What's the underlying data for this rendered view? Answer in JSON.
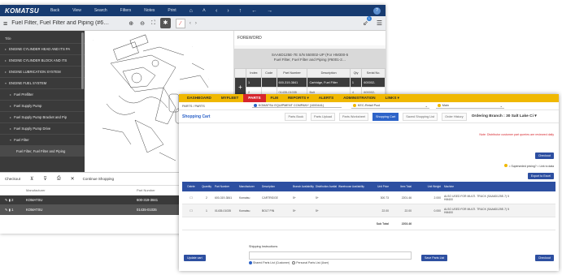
{
  "win1": {
    "top": {
      "logo": "KOMATSU",
      "nav": [
        "Back",
        "View",
        "Search",
        "Filters",
        "Notes",
        "Print"
      ],
      "help": "?"
    },
    "bar": {
      "title": "Fuel Filter, Fuel Filter and Piping (#6…",
      "badge": "1"
    },
    "sidebar": {
      "title": "Title",
      "items": [
        {
          "label": "ENGINE CYLINDER HEAD AND ITS PA"
        },
        {
          "label": "ENGINE CYLINDER BLOCK AND ITS"
        },
        {
          "label": "ENGINE LUBRICATION SYSTEM"
        },
        {
          "label": "ENGINE FUEL SYSTEM"
        },
        {
          "label": "Fuel Prefilter"
        },
        {
          "label": "Fuel Supply Pump"
        },
        {
          "label": "Fuel Supply Pump Bracket and Pip"
        },
        {
          "label": "Fuel Supply Pump Drive"
        },
        {
          "label": "Fuel Filter"
        },
        {
          "label": "Fuel Filter, Fuel Filter and Piping"
        }
      ]
    },
    "foreword": {
      "title": "FOREWORD",
      "grey_line1": "SAA6D125E-7E S/N 550002-UP (For HM300-5",
      "grey_line2": "Fuel Filter, Fuel Filter and Piping (#6001-2…",
      "headers": [
        "Index",
        "Code",
        "Part Number",
        "Description",
        "Qty",
        "Serial No."
      ],
      "rows": [
        {
          "index": "1",
          "code": "",
          "part": "600-319-3841",
          "desc": "Cartridge, Fuel Filter",
          "qty": "1",
          "serial": "600002-"
        },
        {
          "index": "2",
          "code": "",
          "part": "01435-01035",
          "desc": "Bolt",
          "qty": "4",
          "serial": "600002-"
        }
      ]
    },
    "checkout": {
      "label": "Checkout",
      "continue": "Continue Shopping",
      "col_manufacturer": "Manufacturer",
      "col_part": "Part Number",
      "rows": [
        {
          "qty": "2",
          "mfr": "KOMATSU",
          "part": "600-319-3841"
        },
        {
          "qty": "1",
          "mfr": "KOMATSU",
          "part": "01435-01035"
        }
      ]
    }
  },
  "win2": {
    "tabs": [
      "DASHBOARD",
      "MYFLEET",
      "PARTS",
      "FLM",
      "REPORTS ▾",
      "ALERTS",
      "ADMINISTRATION",
      "LINKS ▾"
    ],
    "breadcrumb": "PARTS / PARTS",
    "dealer": "KOMATSU EQUIPMENT COMPANY (1000441)",
    "account": "KEC-Retail Pool",
    "site": "Main",
    "cart_title": "Shopping Cart",
    "subtabs": [
      "Parts Book",
      "Parts Upload",
      "Parts Worksheet",
      "Shopping Cart",
      "Saved Shopping List",
      "Order History"
    ],
    "ordering_branch": "Ordering Branch : 30 Salt Lake Ci ▾",
    "note": "Note: Distributor customer part queries are reviewed daily",
    "checkout_btn": "Checkout",
    "legend": "= Superseded pricing? = Link to data",
    "export_btn": "Export to Excel",
    "headers": [
      "Delete",
      "Quantity",
      "Part Number",
      "Manufacturer",
      "Description",
      "Branch Availability",
      "Distribution Availability",
      "Warehouse Availability",
      "Unit Price",
      "Item Total",
      "Unit Weight",
      "Machine",
      ""
    ],
    "rows": [
      {
        "qty": "2",
        "part": "600-319-3841",
        "mfr": "Komatsu",
        "desc": "CARTRIDGE",
        "branch": "5+",
        "dist": "5+",
        "wh": "",
        "price": "300.73",
        "total": "2201.46",
        "weight": "2.000",
        "machine": "ALSO USED FOR MULTI. TRUCK (SAA6D125E-7) 5 HM400",
        "alt": false
      },
      {
        "qty": "1",
        "part": "01435-01035",
        "mfr": "Komatsu",
        "desc": "BOLT PIN",
        "branch": "5+",
        "dist": "5+",
        "wh": "",
        "price": "22.00",
        "total": "22.00",
        "weight": "0.000",
        "machine": "ALSO USED FOR MULTI. TRUCK (SAA6D125E-7) 5 HM400",
        "alt": true
      }
    ],
    "subtotal_label": "Sub Total",
    "subtotal": "2203.46",
    "update_btn": "Update cart",
    "instructions_label": "Shipping Instructions",
    "radio1": "Shared Parts List (Customer)",
    "radio2": "Personal Parts List (User)",
    "save_list_btn": "Save Parts List",
    "checkout_btn2": "Checkout"
  }
}
